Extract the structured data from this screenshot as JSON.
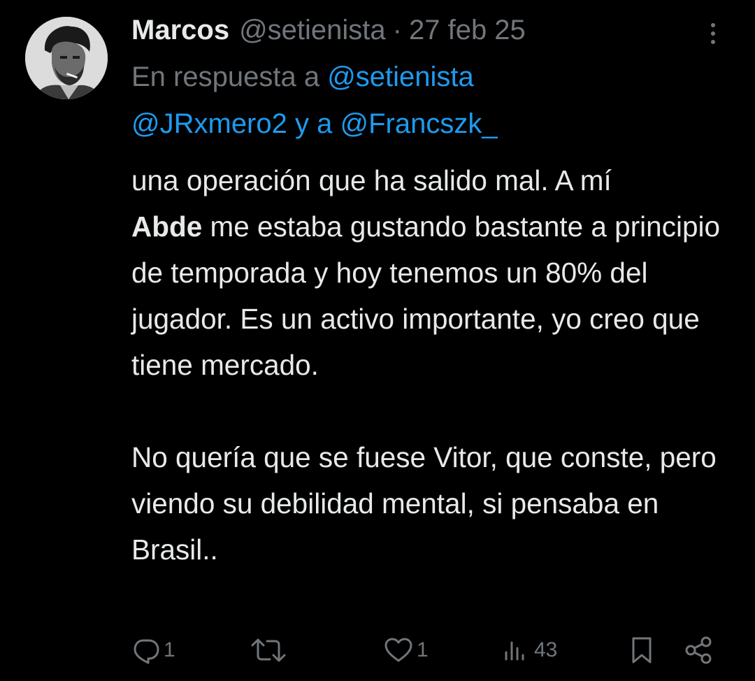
{
  "author": {
    "name": "Marcos",
    "handle": "@setienista",
    "separator": "·",
    "date": "27 feb 25",
    "avatar_icon": "profile-photo"
  },
  "reply": {
    "prefix": "En respuesta a",
    "mention1": "@setienista",
    "mention2": "@JRxmero2",
    "connector": "y a",
    "mention3": "@Francszk_"
  },
  "body": {
    "p1_line1": "una operación que ha salido mal. A mí",
    "p1_bold": "Abde",
    "p1_rest": " me estaba gustando bastante a principio de temporada y hoy tenemos un 80% del jugador. Es un activo importante, yo creo que tiene mercado.",
    "p2": "No quería que se fuese Vitor, que conste, pero viendo su debilidad mental, si pensaba en Brasil.."
  },
  "actions": {
    "replies": "1",
    "likes": "1",
    "views": "43"
  },
  "colors": {
    "background": "#000000",
    "text": "#e7e9ea",
    "muted": "#71767b",
    "link": "#1d9bf0"
  }
}
